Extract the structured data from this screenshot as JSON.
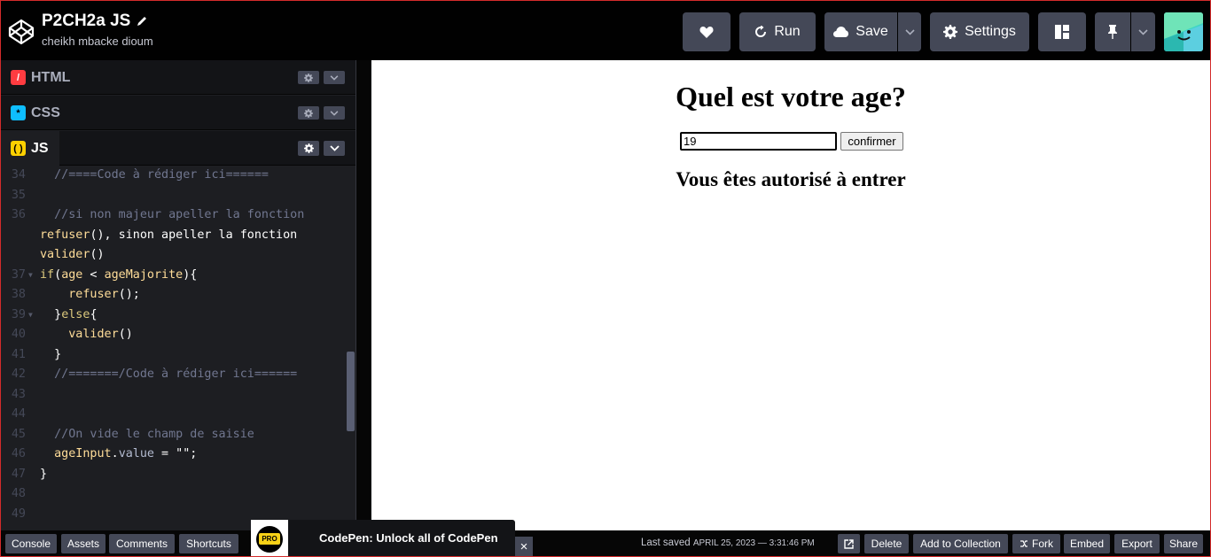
{
  "header": {
    "title": "P2CH2a JS",
    "author": "cheikh mbacke dioum",
    "run_label": "Run",
    "save_label": "Save",
    "settings_label": "Settings"
  },
  "panels": {
    "html": "HTML",
    "css": "CSS",
    "js": "JS"
  },
  "code_lines": [
    {
      "n": "34",
      "text": "  //====Code à rédiger ici======"
    },
    {
      "n": "35",
      "text": ""
    },
    {
      "n": "36",
      "text": "  //si non majeur apeller la fonction"
    },
    {
      "n": "",
      "text": "refuser(), sinon apeller la fonction"
    },
    {
      "n": "",
      "text": "valider()"
    },
    {
      "n": "37",
      "text": "if(age < ageMajorite){"
    },
    {
      "n": "38",
      "text": "    refuser();"
    },
    {
      "n": "39",
      "text": "  }else{"
    },
    {
      "n": "40",
      "text": "    valider()"
    },
    {
      "n": "41",
      "text": "  }"
    },
    {
      "n": "42",
      "text": "  //=======/Code à rédiger ici======"
    },
    {
      "n": "43",
      "text": ""
    },
    {
      "n": "44",
      "text": ""
    },
    {
      "n": "45",
      "text": "  //On vide le champ de saisie"
    },
    {
      "n": "46",
      "text": "  ageInput.value = \"\";"
    },
    {
      "n": "47",
      "text": "}"
    },
    {
      "n": "48",
      "text": ""
    },
    {
      "n": "49",
      "text": ""
    }
  ],
  "preview": {
    "title": "Quel est votre age?",
    "input_value": "19",
    "button_label": "confirmer",
    "message": "Vous êtes autorisé à entrer"
  },
  "footer": {
    "console": "Console",
    "assets": "Assets",
    "comments": "Comments",
    "shortcuts": "Shortcuts",
    "promo_badge": "PRO",
    "promo_text": "CodePen: Unlock all of CodePen",
    "promo_close": "×",
    "last_saved_label": "Last saved",
    "last_saved_date": "APRIL 25, 2023 — 3:31:46 PM",
    "delete": "Delete",
    "add_to_collection": "Add to Collection",
    "fork": "Fork",
    "embed": "Embed",
    "export": "Export",
    "share": "Share"
  },
  "colors": {
    "html_icon": "#ff3c41",
    "css_icon": "#0ebeff",
    "js_icon": "#fcd000",
    "button_bg": "#444857"
  }
}
